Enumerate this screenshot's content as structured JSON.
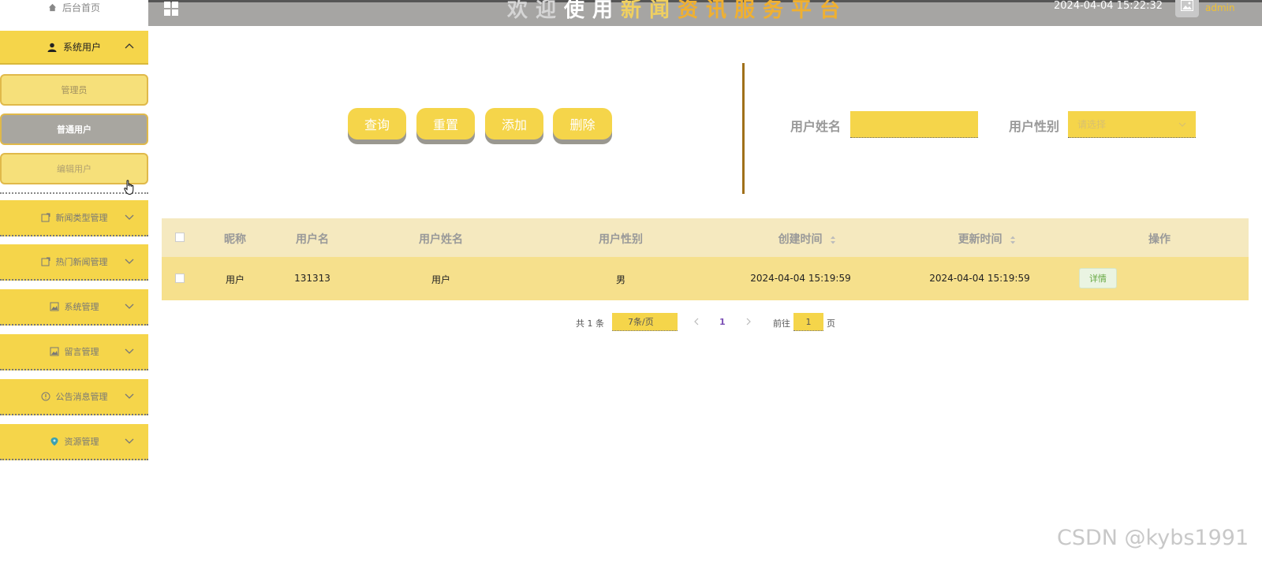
{
  "sidebar": {
    "home": "后台首页",
    "open_menu": {
      "label": "系统用户",
      "children": [
        "管理员",
        "普通用户",
        "编辑用户"
      ]
    },
    "menus": [
      "新闻类型管理",
      "热门新闻管理",
      "系统管理",
      "留言管理",
      "公告消息管理",
      "资源管理"
    ]
  },
  "header": {
    "title_parts": [
      "欢迎",
      "使用",
      "新闻",
      "资讯服务平台"
    ],
    "datetime": "2024-04-04 15:22:32",
    "user": "admin"
  },
  "toolbar": {
    "query": "查询",
    "reset": "重置",
    "add": "添加",
    "delete": "删除"
  },
  "filters": {
    "name_label": "用户姓名",
    "name_value": "",
    "gender_label": "用户性别",
    "gender_placeholder": "请选择"
  },
  "table": {
    "headers": [
      "昵称",
      "用户名",
      "用户姓名",
      "用户性别",
      "创建时间",
      "更新时间",
      "操作"
    ],
    "rows": [
      {
        "nickname": "用户",
        "username": "131313",
        "realname": "用户",
        "gender": "男",
        "created": "2024-04-04 15:19:59",
        "updated": "2024-04-04 15:19:59",
        "action": "详情"
      }
    ]
  },
  "pagination": {
    "total": "共 1 条",
    "page_size": "7条/页",
    "current": "1",
    "goto_prefix": "前往",
    "goto_value": "1",
    "goto_suffix": "页"
  },
  "watermark": "CSDN @kybs1991",
  "colors": {
    "accent": "#f5d54a",
    "header_bg": "#a6a5a3",
    "table_head": "#f5e9bf",
    "table_row": "#f6e08c"
  }
}
